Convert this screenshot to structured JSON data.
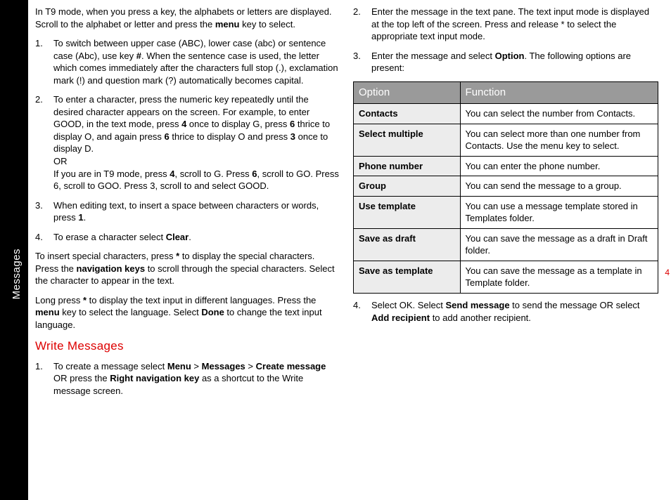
{
  "sidebar": {
    "label": "Messages"
  },
  "pagenum": "4",
  "left": {
    "intro_a": "In T9 mode, when you press a key, the alphabets or letters are displayed. Scroll to the alphabet or letter and press the ",
    "intro_b": "menu",
    "intro_c": " key to select.",
    "li1_a": "To switch between upper case (ABC), lower case (abc) or sentence case (Abc), use key ",
    "li1_b": "#",
    "li1_c": ". When the sentence case is used, the letter which comes immediately after the characters full stop (.), exclamation mark (!) and question mark (?) automatically becomes capital.",
    "li2_a": "To enter a character, press the numeric key repeatedly until the desired character appears on the screen. For example, to enter GOOD, in the text mode, press ",
    "li2_b": "4",
    "li2_c": " once to display G, press ",
    "li2_d": "6",
    "li2_e": " thrice to display O, and again press ",
    "li2_f": "6",
    "li2_g": " thrice to display O and press ",
    "li2_h": "3",
    "li2_i": " once to display D.",
    "li2_or": "OR",
    "li2_j": "If you are in T9 mode, press ",
    "li2_k": "4",
    "li2_l": ", scroll to G. Press ",
    "li2_m": "6",
    "li2_n": ", scroll to GO. Press 6, scroll to GOO. Press 3, scroll to and select GOOD.",
    "li3_a": "When editing text, to insert a space between characters or words, press ",
    "li3_b": "1",
    "li3_c": ".",
    "li4_a": "To erase a character select ",
    "li4_b": "Clear",
    "li4_c": ".",
    "p2_a": "To insert special characters, press ",
    "p2_b": "*",
    "p2_c": " to display the special characters. Press the ",
    "p2_d": "navigation keys",
    "p2_e": " to scroll through the special characters. Select the character to appear in the text.",
    "p3_a": "Long press ",
    "p3_b": "*",
    "p3_c": " to display the text input in different languages. Press the ",
    "p3_d": "menu",
    "p3_e": " key to select the language. Select ",
    "p3_f": "Done",
    "p3_g": " to change the text input language.",
    "sec": "Write Messages",
    "wm1_a": "To create a message select ",
    "wm1_b": "Menu",
    "wm1_c": " > ",
    "wm1_d": "Messages",
    "wm1_e": " > ",
    "wm1_f": "Create message",
    "wm1_g": " OR press the ",
    "wm1_h": "Right navigation key",
    "wm1_i": " as a shortcut to the Write message screen."
  },
  "right": {
    "li2": "Enter the message in the text pane. The text input mode is displayed at the top left of the screen. Press and release * to select the appropriate text input mode.",
    "li3_a": "Enter the message and select ",
    "li3_b": "Option",
    "li3_c": ". The following options are present:",
    "th1": "Option",
    "th2": "Function",
    "rows": [
      {
        "opt": "Contacts",
        "fn": "You can select the number from Contacts."
      },
      {
        "opt": "Select multiple",
        "fn": "You can select more than one number from Contacts. Use the menu key to select."
      },
      {
        "opt": "Phone number",
        "fn": "You can enter the phone number."
      },
      {
        "opt": "Group",
        "fn": "You can send the message to a group."
      },
      {
        "opt": "Use template",
        "fn": "You can use a message template stored in Templates folder."
      },
      {
        "opt": "Save as draft",
        "fn": "You can save the message as a draft in Draft folder."
      },
      {
        "opt": "Save as template",
        "fn": "You can save the message as a template in Template folder."
      }
    ],
    "li4_a": "Select OK. Select ",
    "li4_b": "Send message",
    "li4_c": " to send the message OR select ",
    "li4_d": "Add recipient",
    "li4_e": " to add another recipient."
  }
}
